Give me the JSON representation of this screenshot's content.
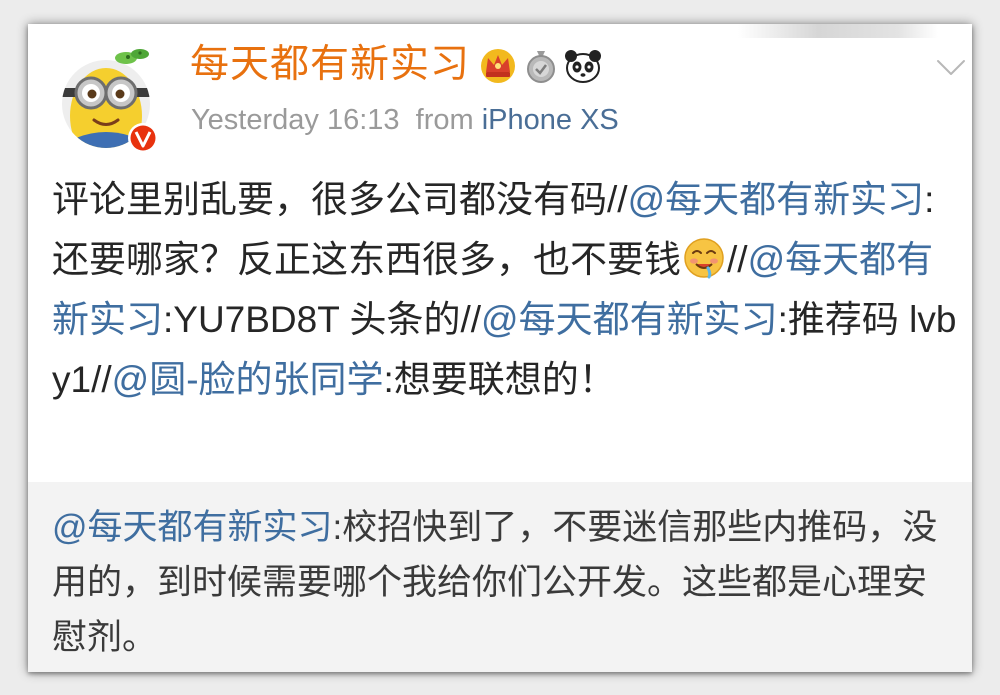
{
  "post": {
    "username": "每天都有新实习",
    "timestamp": "Yesterday 16:13",
    "from_label": "from",
    "device": "iPhone XS",
    "text_1": "评论里别乱要，很多公司都没有码//",
    "mention_1": "@每天都有新实习",
    "text_2": ":还要哪家？反正这东西很多，也不要钱",
    "text_3": "//",
    "mention_2": "@每天都有新实习",
    "text_4": ":YU7BD8T 头条的//",
    "mention_3": "@每天都有新实习",
    "text_5": ":推荐码 lvby1//",
    "mention_4": "@圆-脸的张同学",
    "text_6": ":想要联想的！"
  },
  "quote": {
    "mention": "@每天都有新实习",
    "text": ":校招快到了，不要迷信那些内推码，没用的，到时候需要哪个我给你们公开发。这些都是心理安慰剂。"
  },
  "badges": [
    "crown-badge-icon",
    "medal-badge-icon",
    "panda-badge-icon"
  ],
  "emoji": "drooling-face-icon",
  "colors": {
    "username": "#e8710f",
    "mention": "#3f6ea0",
    "meta": "#9a9a9a",
    "quote_bg": "#f3f3f3",
    "verified": "#e8320e"
  }
}
